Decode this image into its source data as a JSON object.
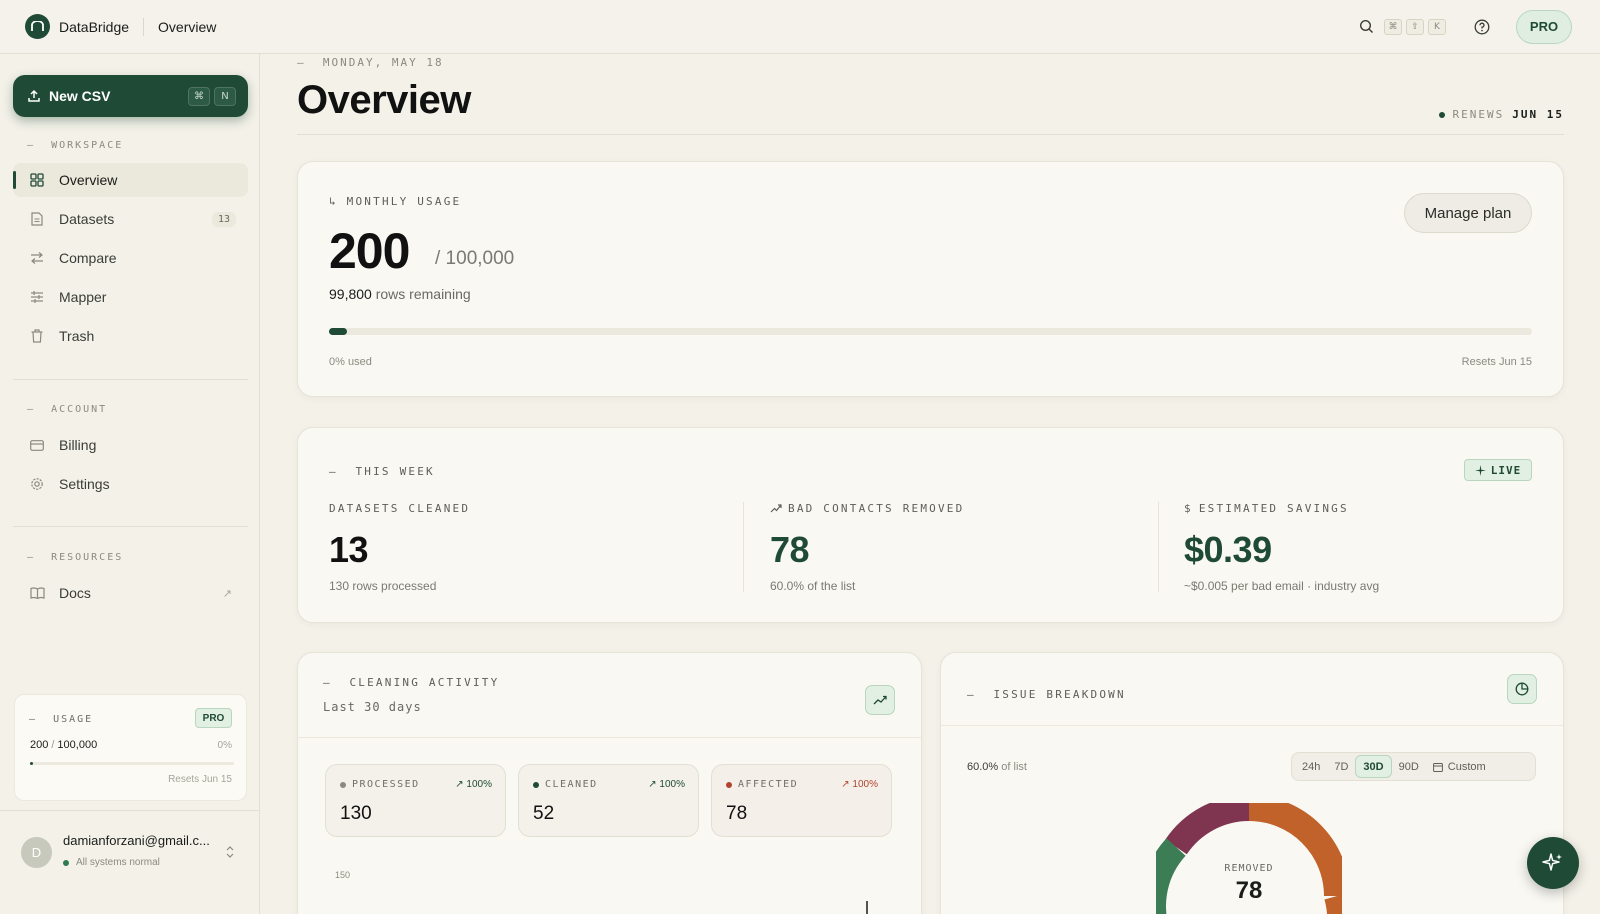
{
  "app": {
    "name": "DataBridge",
    "breadcrumb": "Overview"
  },
  "topbar": {
    "shortcut_keys": [
      "⌘",
      "⇧",
      "K"
    ],
    "plan_badge": "PRO"
  },
  "sidebar": {
    "new_csv": {
      "label": "New CSV",
      "keys": [
        "⌘",
        "N"
      ]
    },
    "sections": {
      "workspace": "WORKSPACE",
      "account": "ACCOUNT",
      "resources": "RESOURCES"
    },
    "workspace_items": [
      {
        "label": "Overview",
        "icon": "grid-icon",
        "active": true
      },
      {
        "label": "Datasets",
        "icon": "file-icon",
        "badge": "13"
      },
      {
        "label": "Compare",
        "icon": "arrows-icon"
      },
      {
        "label": "Mapper",
        "icon": "sliders-icon"
      },
      {
        "label": "Trash",
        "icon": "trash-icon"
      }
    ],
    "account_items": [
      {
        "label": "Billing",
        "icon": "card-icon"
      },
      {
        "label": "Settings",
        "icon": "gear-icon"
      }
    ],
    "resource_items": [
      {
        "label": "Docs",
        "icon": "book-icon",
        "ext": "↗"
      }
    ],
    "usage": {
      "title": "USAGE",
      "badge": "PRO",
      "used": "200",
      "limit": "100,000",
      "percent": "0%",
      "fraction": 0.002,
      "resets": "Resets Jun 15"
    },
    "user": {
      "initial": "D",
      "email": "damianforzani@gmail.c...",
      "status": "All systems normal"
    }
  },
  "main": {
    "date": "MONDAY, MAY 18",
    "title": "Overview",
    "renews_label": "RENEWS",
    "renews_date": "JUN 15",
    "monthly_usage": {
      "label": "MONTHLY USAGE",
      "used": "200",
      "limit": "/ 100,000",
      "remaining_num": "99,800",
      "remaining_text": "rows remaining",
      "fraction": 0.002,
      "used_text": "0% used",
      "resets": "Resets Jun 15",
      "manage": "Manage plan"
    },
    "this_week": {
      "label": "THIS WEEK",
      "live": "LIVE",
      "stats": [
        {
          "label": "DATASETS CLEANED",
          "value": "13",
          "sub": "130 rows processed"
        },
        {
          "label": "BAD CONTACTS REMOVED",
          "value": "78",
          "sub": "60.0% of the list"
        },
        {
          "label": "ESTIMATED SAVINGS",
          "value": "$0.39",
          "sub": "~$0.005 per bad email · industry avg"
        }
      ]
    },
    "cleaning_activity": {
      "label": "CLEANING ACTIVITY",
      "period": "Last 30 days",
      "metrics": [
        {
          "label": "PROCESSED",
          "pct": "100%",
          "value": "130",
          "color": "#8a8a80"
        },
        {
          "label": "CLEANED",
          "pct": "100%",
          "value": "52",
          "color": "#1f4a36"
        },
        {
          "label": "AFFECTED",
          "pct": "100%",
          "value": "78",
          "color": "#b0452f"
        }
      ],
      "y_tick": "150"
    },
    "issue_breakdown": {
      "label": "ISSUE BREAKDOWN",
      "of_list_pct": "60.0%",
      "of_list_text": "of list",
      "ranges": [
        "24h",
        "7D",
        "30D",
        "90D",
        "Custom"
      ],
      "selected_range": "30D",
      "donut_label": "REMOVED",
      "donut_value": "78",
      "colors": {
        "orange": "#c0622a",
        "maroon": "#7f3450",
        "green": "#3d7d55"
      }
    }
  },
  "colors": {
    "accent": "#1f4a36",
    "background": "#f3f1e8"
  }
}
